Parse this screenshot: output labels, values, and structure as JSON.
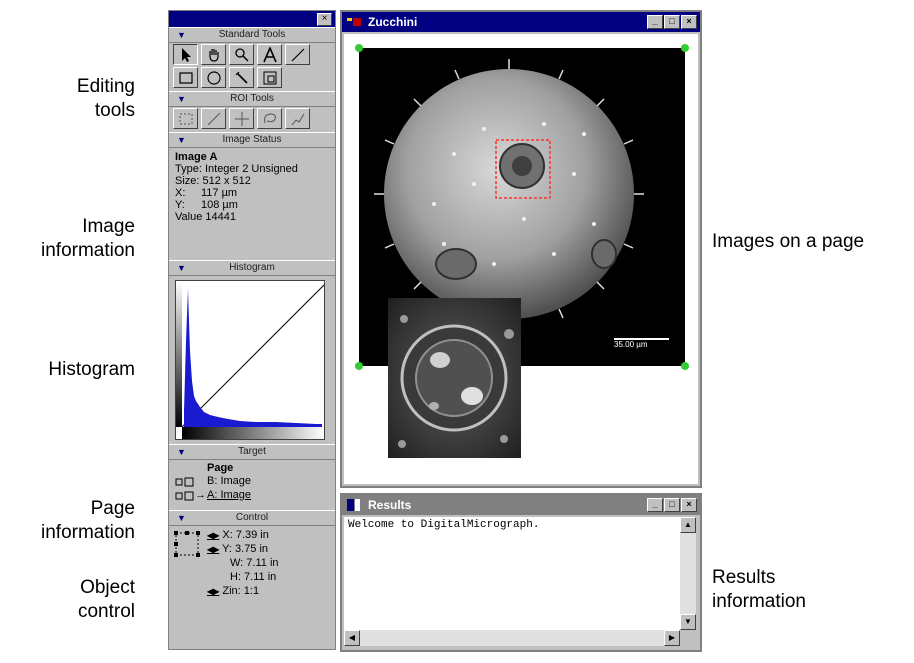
{
  "callouts": {
    "editing_tools": [
      "Editing",
      "tools"
    ],
    "image_information": [
      "Image",
      "information"
    ],
    "histogram": "Histogram",
    "page_information": [
      "Page",
      "information"
    ],
    "object_control": [
      "Object",
      "control"
    ],
    "images_on_page": "Images on a page",
    "results_information": [
      "Results",
      "information"
    ]
  },
  "palette": {
    "close_glyph": "×",
    "sections": {
      "standard_tools": "Standard Tools",
      "roi_tools": "ROI Tools",
      "image_status": "Image Status",
      "histogram": "Histogram",
      "target": "Target",
      "control": "Control"
    },
    "standard_tools": [
      "arrow-icon",
      "hand-icon",
      "zoom-icon",
      "text-icon",
      "line-icon",
      "rectangle-icon",
      "oval-icon",
      "wand-icon",
      "crop-icon"
    ],
    "roi_tools": [
      "rect-roi-icon",
      "line-roi-icon",
      "point-roi-icon",
      "lasso-roi-icon",
      "polyline-roi-icon"
    ],
    "image_status": {
      "name": "Image A",
      "type": "Type: Integer 2 Unsigned",
      "size_label": "Size:",
      "size_value": "512 x 512",
      "x_label": "X:",
      "x_value": "117 µm",
      "y_label": "Y:",
      "y_value": "108 µm",
      "value": "Value 14441"
    },
    "target": {
      "page": "Page",
      "b": "B: Image",
      "a": "A: Image",
      "arrow": "→"
    },
    "control": {
      "x": "X: 7.39 in",
      "y": "Y: 3.75 in",
      "w": "W: 7.11 in",
      "h": "H: 7.11 in",
      "zin": "Zin: 1:1"
    }
  },
  "image_window": {
    "title": "Zucchini",
    "scale_bar": "35.00 µm",
    "accent": "#000080"
  },
  "results_window": {
    "title": "Results",
    "text": "Welcome to DigitalMicrograph."
  }
}
